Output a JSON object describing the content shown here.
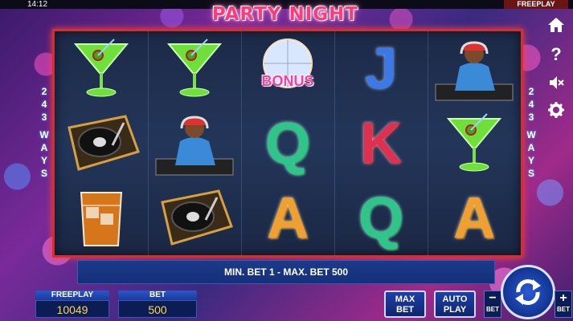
{
  "status_bar": {
    "time": "14:12",
    "mode": "FREEPLAY"
  },
  "game": {
    "title": "PARTY NIGHT"
  },
  "ways": {
    "count_digits": [
      "2",
      "4",
      "3"
    ],
    "word_letters": [
      "W",
      "A",
      "Y",
      "S"
    ]
  },
  "reels": [
    [
      "martini-glass-symbol",
      "turntable-symbol",
      "whiskey-glass-symbol"
    ],
    [
      "martini-glass-symbol",
      "dj-symbol",
      "turntable-symbol"
    ],
    [
      "disco-ball-bonus-symbol",
      "letter-q-symbol",
      "letter-a-symbol"
    ],
    [
      "letter-j-symbol",
      "letter-k-symbol",
      "letter-q-symbol"
    ],
    [
      "dj-symbol",
      "martini-glass-symbol",
      "letter-a-symbol"
    ]
  ],
  "bonus_label": "BONUS",
  "letters": {
    "j": "J",
    "k": "K",
    "q": "Q",
    "a": "A"
  },
  "side_menu": [
    "home-icon",
    "help-icon",
    "sound-off-icon",
    "settings-icon"
  ],
  "info_bar": {
    "text": "MIN. BET 1 - MAX. BET 500"
  },
  "balance": {
    "label": "FREEPLAY",
    "value": "10049"
  },
  "bet": {
    "label": "BET",
    "value": "500"
  },
  "buttons": {
    "max_bet": {
      "line1": "MAX",
      "line2": "BET"
    },
    "autoplay": {
      "line1": "AUTO",
      "line2": "PLAY"
    },
    "bet_minus": {
      "symbol": "−",
      "label": "BET"
    },
    "bet_plus": {
      "symbol": "+",
      "label": "BET"
    }
  },
  "colors": {
    "frame": "#d23030",
    "accent_blue": "#1e3fa6",
    "value_yellow": "#ffd84a"
  }
}
